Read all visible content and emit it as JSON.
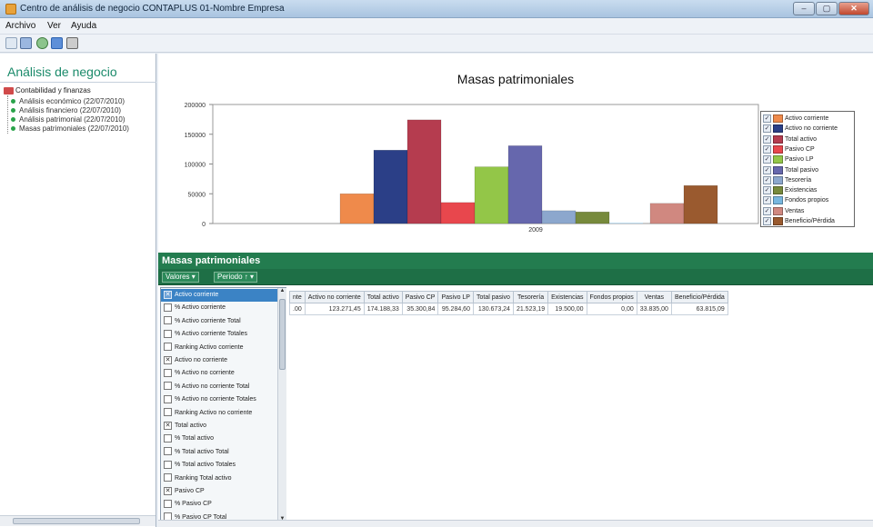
{
  "window": {
    "title": "Centro de análisis de negocio CONTAPLUS 01-Nombre Empresa",
    "controls": {
      "minimize": "–",
      "maximize": "▢",
      "close": "✕"
    }
  },
  "menu": {
    "archivo": "Archivo",
    "ver": "Ver",
    "ayuda": "Ayuda"
  },
  "toolbar": {
    "icons": [
      "back-icon",
      "calendar-icon",
      "refresh-icon",
      "chart-icon",
      "print-icon"
    ]
  },
  "sidebar": {
    "title": "Análisis de negocio",
    "root": "Contabilidad y finanzas",
    "items": [
      {
        "label": "Análisis económico (22/07/2010)"
      },
      {
        "label": "Análisis financiero (22/07/2010)"
      },
      {
        "label": "Análisis patrimonial (22/07/2010)"
      },
      {
        "label": "Masas patrimoniales (22/07/2010)"
      }
    ]
  },
  "chart_data": {
    "type": "bar",
    "title": "Masas patrimoniales",
    "categories": [
      "2009"
    ],
    "ylim": [
      0,
      200000
    ],
    "yticks": [
      "200000",
      "150000",
      "100000",
      "50000",
      "0"
    ],
    "grid": false,
    "legend_position": "right",
    "series": [
      {
        "name": "Activo corriente",
        "value": 50000,
        "color": "#ef8a4b"
      },
      {
        "name": "Activo no corriente",
        "value": 123271.45,
        "color": "#2b3f87"
      },
      {
        "name": "Total activo",
        "value": 174188.33,
        "color": "#b53c4f"
      },
      {
        "name": "Pasivo CP",
        "value": 35300.84,
        "color": "#e8474d"
      },
      {
        "name": "Pasivo LP",
        "value": 95284.6,
        "color": "#93c648"
      },
      {
        "name": "Total pasivo",
        "value": 130673.24,
        "color": "#6667ad"
      },
      {
        "name": "Tesorería",
        "value": 21523.19,
        "color": "#8ca7cd"
      },
      {
        "name": "Existencias",
        "value": 19500,
        "color": "#778a3c"
      },
      {
        "name": "Fondos propios",
        "value": 0,
        "color": "#78b7df"
      },
      {
        "name": "Ventas",
        "value": 33835,
        "color": "#d08880"
      },
      {
        "name": "Beneficio/Pérdida",
        "value": 63815.09,
        "color": "#9a5a2f"
      }
    ]
  },
  "grid": {
    "title": "Masas patrimoniales",
    "valores_label": "Valores",
    "periodo_label": "Periodo",
    "dropdown": [
      {
        "label": "Activo corriente",
        "checked": true,
        "selected": true
      },
      {
        "label": "% Activo corriente",
        "checked": false
      },
      {
        "label": "% Activo corriente Total",
        "checked": false
      },
      {
        "label": "% Activo corriente Totales",
        "checked": false
      },
      {
        "label": "Ranking Activo corriente",
        "checked": false
      },
      {
        "label": "Activo no corriente",
        "checked": true
      },
      {
        "label": "% Activo no corriente",
        "checked": false
      },
      {
        "label": "% Activo no corriente Total",
        "checked": false
      },
      {
        "label": "% Activo no corriente Totales",
        "checked": false
      },
      {
        "label": "Ranking Activo no corriente",
        "checked": false
      },
      {
        "label": "Total activo",
        "checked": true
      },
      {
        "label": "% Total activo",
        "checked": false
      },
      {
        "label": "% Total activo Total",
        "checked": false
      },
      {
        "label": "% Total activo Totales",
        "checked": false
      },
      {
        "label": "Ranking Total activo",
        "checked": false
      },
      {
        "label": "Pasivo CP",
        "checked": true
      },
      {
        "label": "% Pasivo CP",
        "checked": false
      },
      {
        "label": "% Pasivo CP Total",
        "checked": false
      }
    ],
    "columns": [
      "nte",
      "Activo no corriente",
      "Total activo",
      "Pasivo CP",
      "Pasivo LP",
      "Total pasivo",
      "Tesorería",
      "Existencias",
      "Fondos propios",
      "Ventas",
      "Beneficio/Pérdida"
    ],
    "row": [
      ".00",
      "123.271,45",
      "174.188,33",
      "35.300,84",
      "95.284,60",
      "130.673,24",
      "21.523,19",
      "19.500,00",
      "0,00",
      "33.835,00",
      "63.815,09"
    ]
  }
}
